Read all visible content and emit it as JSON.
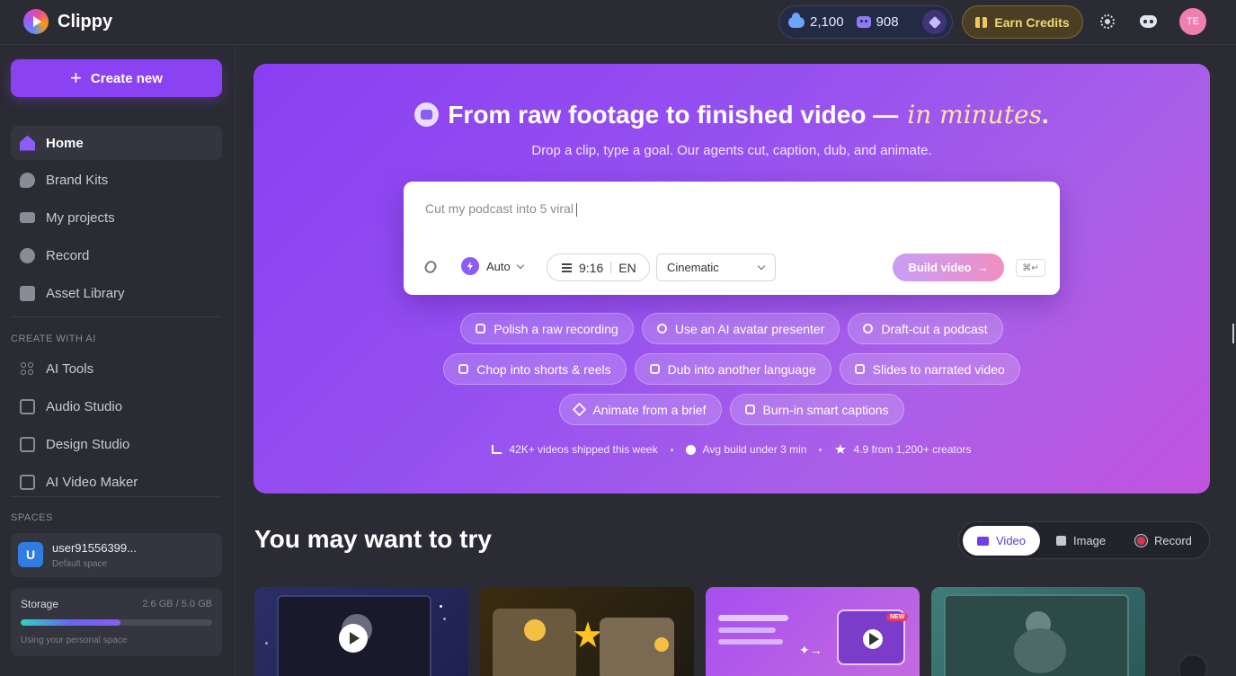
{
  "app": {
    "name": "Clippy"
  },
  "topbar": {
    "cloud_credits": "2,100",
    "agent_credits": "908",
    "earn_label": "Earn Credits",
    "avatar_initials": "TE"
  },
  "sidebar": {
    "create_label": "Create new",
    "main_items": [
      {
        "label": "Home",
        "icon": "home-icon",
        "active": true
      },
      {
        "label": "Brand Kits",
        "icon": "palette-icon"
      },
      {
        "label": "My projects",
        "icon": "video-camera-icon"
      },
      {
        "label": "Record",
        "icon": "record-icon"
      },
      {
        "label": "Asset Library",
        "icon": "library-icon"
      }
    ],
    "create_ai_title": "CREATE WITH AI",
    "ai_items": [
      {
        "label": "AI Tools",
        "icon": "grid-icon"
      },
      {
        "label": "Audio Studio",
        "icon": "audio-icon"
      },
      {
        "label": "Design Studio",
        "icon": "design-icon"
      },
      {
        "label": "AI Video Maker",
        "icon": "film-icon"
      }
    ],
    "spaces_title": "SPACES",
    "space": {
      "avatar": "U",
      "name": "user91556399...",
      "subtitle": "Default space"
    },
    "storage": {
      "label": "Storage",
      "value": "2.6 GB / 5.0 GB",
      "used_fraction": 0.52,
      "subtitle": "Using your personal space"
    }
  },
  "hero": {
    "title": "From raw footage to finished video —",
    "title_accent": "in minutes",
    "title_end": ".",
    "subtitle": "Drop a clip, type a goal. Our agents cut, caption, dub, and animate.",
    "prompt_text": "Cut my podcast into 5 viral",
    "mode_label": "Auto",
    "ratio": "9:16",
    "language": "EN",
    "style": "Cinematic",
    "build_label": "Build video",
    "shortcut": "⌘↵",
    "chips_row1": [
      "Polish a raw recording",
      "Use an AI avatar presenter",
      "Draft-cut a podcast"
    ],
    "chips_row2": [
      "Chop into shorts & reels",
      "Dub into another language",
      "Slides to narrated video"
    ],
    "chips_row3": [
      "Animate from a brief",
      "Burn-in smart captions"
    ],
    "stats": [
      "42K+ videos shipped this week",
      "Avg build under 3 min",
      "4.9 from 1,200+ creators"
    ]
  },
  "try_section": {
    "title": "You may want to try",
    "tabs": [
      "Video",
      "Image",
      "Record"
    ],
    "new_badge": "NEW"
  },
  "colors": {
    "accent": "#8b42f2",
    "hero_start": "#8a3ff2",
    "hero_end": "#c154e0",
    "earn_text": "#f4d67a"
  }
}
